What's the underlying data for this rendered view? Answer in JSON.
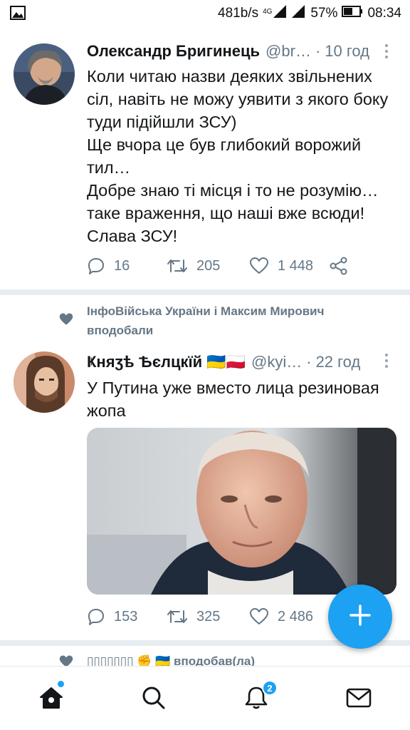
{
  "status_bar": {
    "speed": "481b/s",
    "network": "4G",
    "battery": "57%",
    "time": "08:34"
  },
  "tweets": [
    {
      "name": "Олександр Бригинець",
      "handle": "@br…",
      "time": "10 год",
      "text": "Коли читаю назви деяких звільнених сіл, навіть не можу уявити з якого боку туди підійшли ЗСУ)\nЩе вчора це був глибокий ворожий тил…\nДобре знаю ті місця і то не розумію… таке враження, що наші вже всюди!\nСлава ЗСУ!",
      "replies": "16",
      "retweets": "205",
      "likes": "1 448"
    },
    {
      "social_context": "ІнфоВійська України і Максим Мирович вподобали",
      "name": "Ҝняӡѣ Ѣєлцкїй",
      "flags": "🇺🇦🇵🇱",
      "handle": "@kyi…",
      "time": "22 год",
      "text": "У Путина уже вместо лица резиновая жопа",
      "replies": "153",
      "retweets": "325",
      "likes": "2 486"
    }
  ],
  "partial_social_context": "▯▯▯▯▯▯▯ ✊ 🇺🇦 вподобав(ла)",
  "notifications_badge": "2",
  "icons": {
    "gallery": "image-icon",
    "reply": "reply-icon",
    "retweet": "retweet-icon",
    "like": "heart-icon",
    "share": "share-icon",
    "compose": "plus-icon",
    "home": "home-icon",
    "search": "search-icon",
    "notifications": "bell-icon",
    "messages": "mail-icon"
  },
  "colors": {
    "accent": "#1da1f2",
    "secondary_text": "#657786",
    "divider": "#e6ecf0"
  }
}
